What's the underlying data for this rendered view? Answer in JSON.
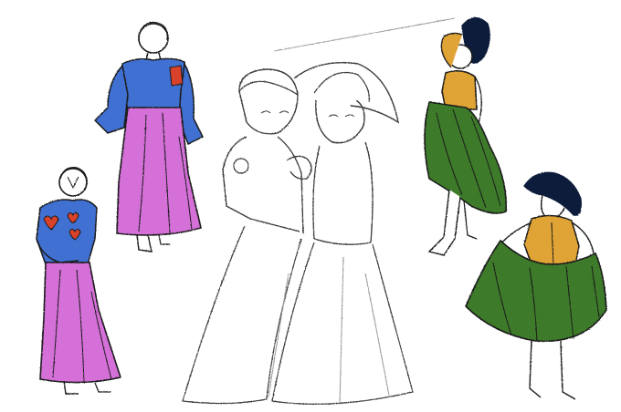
{
  "artwork": {
    "background": "#ffffff",
    "line_color": "#1a1a1a",
    "light_line_color": "#8a8a8a",
    "figures": [
      {
        "name": "figure-blue-top-pink-skirt-back",
        "top": "#3f6fd1",
        "skirt": "#d46fd8",
        "accent": "#d9432a"
      },
      {
        "name": "figure-blue-top-pink-skirt-front",
        "top": "#3f6fd1",
        "skirt": "#d46fd8",
        "accent": "#d9432a"
      },
      {
        "name": "couple-sketch",
        "top": "#ffffff",
        "skirt": "#ffffff"
      },
      {
        "name": "figure-green-skirt-hat-raised",
        "top": "#e0a336",
        "skirt": "#3e7a2c",
        "hat": "#0f1f3a"
      },
      {
        "name": "figure-green-skirt-hat-back",
        "top": "#e0a336",
        "skirt": "#3e7a2c",
        "hat": "#0f1f3a"
      }
    ]
  }
}
